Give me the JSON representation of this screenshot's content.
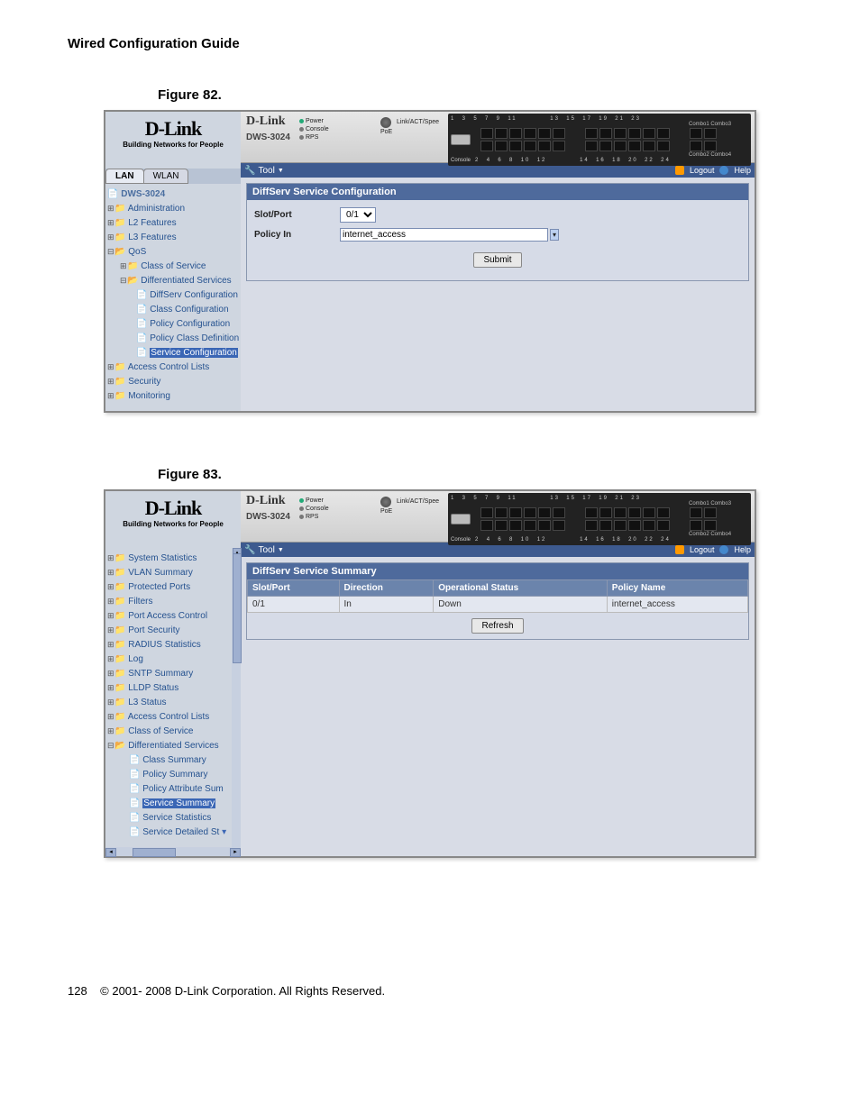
{
  "doc": {
    "title": "Wired Configuration Guide",
    "fig82_label": "Figure 82.",
    "fig83_label": "Figure 83.",
    "page_num": "128",
    "copyright": "© 2001- 2008 D-Link Corporation. All Rights Reserved."
  },
  "logo": {
    "main": "D-Link",
    "tag": "Building Networks for People"
  },
  "device_hdr": {
    "brand": "D-Link",
    "model": "DWS-3024",
    "leds": {
      "a": "Power",
      "b": "Console",
      "c": "RPS"
    },
    "leds2": {
      "a": "Link/ACT/Spee",
      "b": "PoE"
    },
    "console": "Console",
    "combo1": "Combo1 Combo3",
    "combo2": "Combo2 Combo4",
    "top_nums": "1  3  5  7  9  11          13  15  17  19  21  23",
    "bot_nums": "2  4  6  8  10  12          14  16  18  20  22  24"
  },
  "toolbar": {
    "tool": "Tool",
    "logout": "Logout",
    "help": "Help"
  },
  "fig82": {
    "tabs": {
      "lan": "LAN",
      "wlan": "WLAN"
    },
    "tree": {
      "root": "DWS-3024",
      "admin": "Administration",
      "l2": "L2 Features",
      "l3": "L3 Features",
      "qos": "QoS",
      "cos": "Class of Service",
      "ds": "Differentiated Services",
      "dsconf": "DiffServ Configuration",
      "cconf": "Class Configuration",
      "pconf": "Policy Configuration",
      "pcd": "Policy Class Definition",
      "sconf": "Service Configuration",
      "acl": "Access Control Lists",
      "sec": "Security",
      "mon": "Monitoring"
    },
    "panel": {
      "title": "DiffServ Service Configuration",
      "slot_label": "Slot/Port",
      "slot_val": "0/1",
      "policy_label": "Policy In",
      "policy_val": "internet_access",
      "submit": "Submit"
    }
  },
  "fig83": {
    "tree": {
      "sys": "System Statistics",
      "vlan": "VLAN Summary",
      "pp": "Protected Ports",
      "filt": "Filters",
      "pac": "Port Access Control",
      "ps": "Port Security",
      "rad": "RADIUS Statistics",
      "log": "Log",
      "sntp": "SNTP Summary",
      "lldp": "LLDP Status",
      "l3": "L3 Status",
      "acl": "Access Control Lists",
      "cos": "Class of Service",
      "ds": "Differentiated Services",
      "csum": "Class Summary",
      "psum": "Policy Summary",
      "pas": "Policy Attribute Sum",
      "ssum": "Service Summary",
      "sstat": "Service Statistics",
      "sds": "Service Detailed St"
    },
    "panel": {
      "title": "DiffServ Service Summary",
      "h1": "Slot/Port",
      "h2": "Direction",
      "h3": "Operational Status",
      "h4": "Policy Name",
      "r1c1": "0/1",
      "r1c2": "In",
      "r1c3": "Down",
      "r1c4": "internet_access",
      "refresh": "Refresh"
    }
  }
}
